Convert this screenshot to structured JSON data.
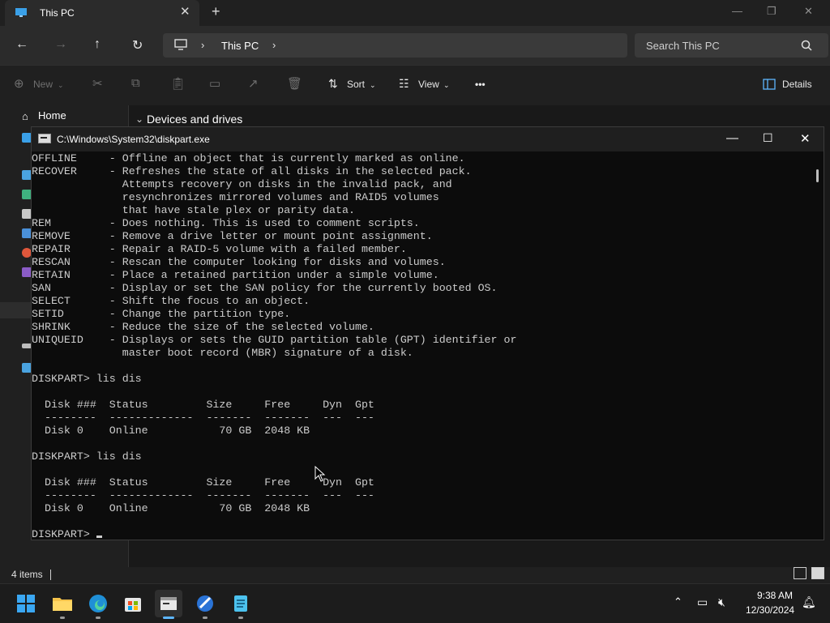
{
  "explorer": {
    "tab_title": "This PC",
    "address": {
      "location": "This PC"
    },
    "search_placeholder": "Search This PC",
    "commands": {
      "new_label": "New",
      "sort_label": "Sort",
      "view_label": "View",
      "more_label": "•••",
      "details_label": "Details"
    },
    "sidebar": {
      "home_label": "Home"
    },
    "section_title": "Devices and drives",
    "status_items": "4 items"
  },
  "console": {
    "title": "C:\\Windows\\System32\\diskpart.exe",
    "lines": [
      "OFFLINE     - Offline an object that is currently marked as online.",
      "RECOVER     - Refreshes the state of all disks in the selected pack.",
      "              Attempts recovery on disks in the invalid pack, and",
      "              resynchronizes mirrored volumes and RAID5 volumes",
      "              that have stale plex or parity data.",
      "REM         - Does nothing. This is used to comment scripts.",
      "REMOVE      - Remove a drive letter or mount point assignment.",
      "REPAIR      - Repair a RAID-5 volume with a failed member.",
      "RESCAN      - Rescan the computer looking for disks and volumes.",
      "RETAIN      - Place a retained partition under a simple volume.",
      "SAN         - Display or set the SAN policy for the currently booted OS.",
      "SELECT      - Shift the focus to an object.",
      "SETID       - Change the partition type.",
      "SHRINK      - Reduce the size of the selected volume.",
      "UNIQUEID    - Displays or sets the GUID partition table (GPT) identifier or",
      "              master boot record (MBR) signature of a disk.",
      "",
      "DISKPART> lis dis",
      "",
      "  Disk ###  Status         Size     Free     Dyn  Gpt",
      "  --------  -------------  -------  -------  ---  ---",
      "  Disk 0    Online           70 GB  2048 KB",
      "",
      "DISKPART> lis dis",
      "",
      "  Disk ###  Status         Size     Free     Dyn  Gpt",
      "  --------  -------------  -------  -------  ---  ---",
      "  Disk 0    Online           70 GB  2048 KB",
      ""
    ],
    "prompt": "DISKPART> "
  },
  "taskbar": {
    "time": "9:38 AM",
    "date": "12/30/2024",
    "apps": [
      "start-icon",
      "file-explorer-icon",
      "edge-icon",
      "store-icon",
      "terminal-icon",
      "app-icon",
      "notepad-icon"
    ]
  },
  "colors": {
    "accent": "#5eb6ff",
    "console_bg": "#0c0c0c",
    "console_text": "#cccccc"
  }
}
